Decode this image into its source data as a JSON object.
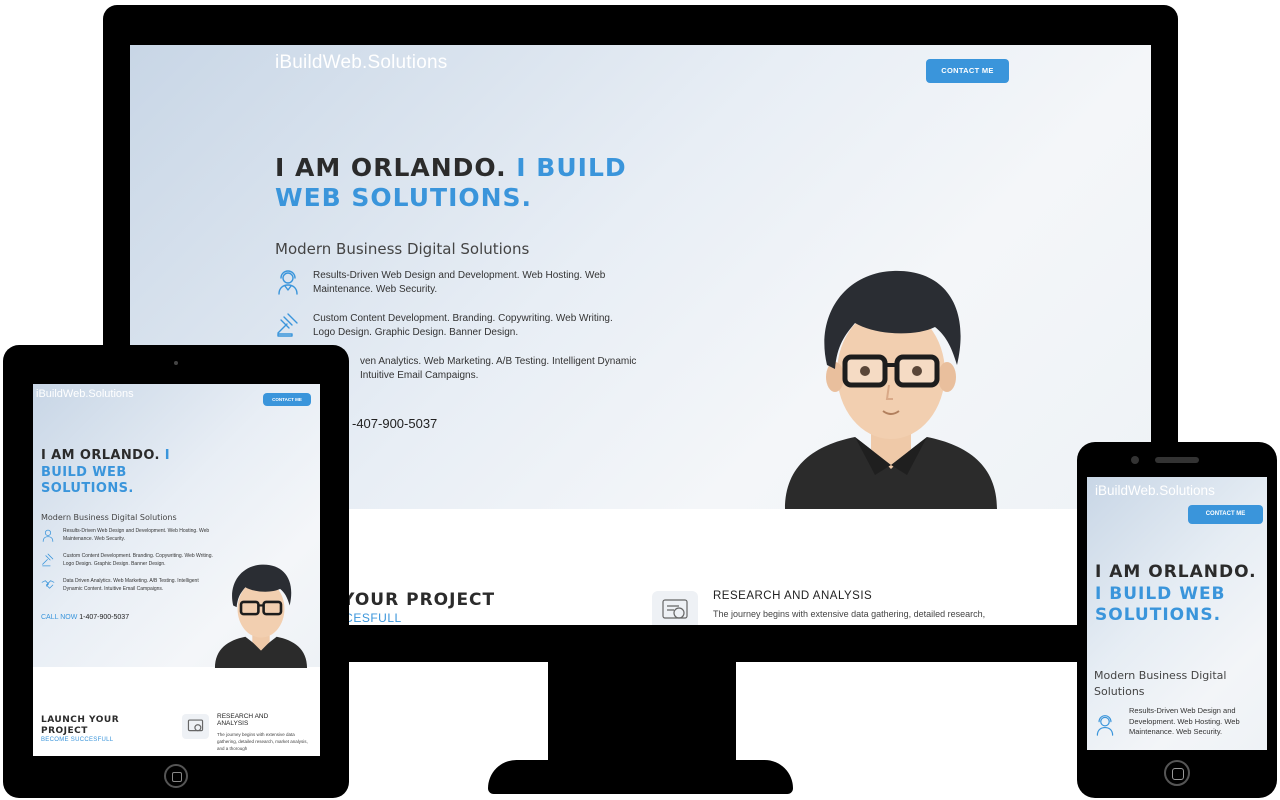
{
  "site": {
    "brand": "iBuildWeb.Solutions",
    "contact_button": "CONTACT ME",
    "headline_part1": "I AM ORLANDO. ",
    "headline_part2": "I BUILD WEB SOLUTIONS.",
    "subtitle": "Modern Business Digital Solutions",
    "features": [
      {
        "icon": "support-agent-icon",
        "text": "Results-Driven Web Design and Development. Web Hosting. Web Maintenance. Web Security."
      },
      {
        "icon": "gavel-icon",
        "text": "Custom Content Development. Branding. Copywriting. Web Writing. Logo Design. Graphic Design. Banner Design."
      },
      {
        "icon": "handshake-icon",
        "text": "Data Driven Analytics. Web Marketing. A/B Testing. Intelligent Dynamic Content. Intuitive Email Campaigns."
      }
    ],
    "call_label": "CALL NOW",
    "phone": "1-407-900-5037",
    "launch_title": "LAUNCH YOUR PROJECT",
    "launch_subtitle": "BECOME SUCCESFULL",
    "research_title": "RESEARCH AND ANALYSIS",
    "research_text": "The journey begins with extensive data gathering, detailed research, market analysis, and a thorough"
  },
  "monitor_view": {
    "headline_part1": "I AM ORLANDO. ",
    "headline_part2": "I BUILD WEB SOLUTIONS.",
    "feature3_visible": "ven Analytics. Web Marketing. A/B Testing. Intelligent Dynamic",
    "feature3_visible_line2": "Intuitive Email Campaigns.",
    "phone_visible": "-407-900-5037",
    "launch_visible": "H YOUR PROJECT",
    "become_visible": "CCESFULL",
    "research_text_visible": "The journey begins with extensive data gathering, detailed research,"
  },
  "tablet_view": {
    "headline": "I AM ORLANDO. ",
    "headline_accent": "I BUILD WEB SOLUTIONS.",
    "launch_title": "LAUNCH YOUR PROJECT",
    "research_title": "RESEARCH AND ANALYSIS",
    "research_text": "The journey begins with extensive data gathering, detailed research, market analysis, and a thorough"
  },
  "phone_view": {
    "headline": "I AM ORLANDO. ",
    "headline_accent": "I BUILD WEB SOLUTIONS.",
    "subtitle": "Modern Business Digital Solutions",
    "feature1": "Results-Driven Web Design and Development. Web Hosting. Web Maintenance. Web Security."
  },
  "colors": {
    "accent": "#3a95db",
    "text": "#2b2b2b",
    "device": "#000000"
  }
}
